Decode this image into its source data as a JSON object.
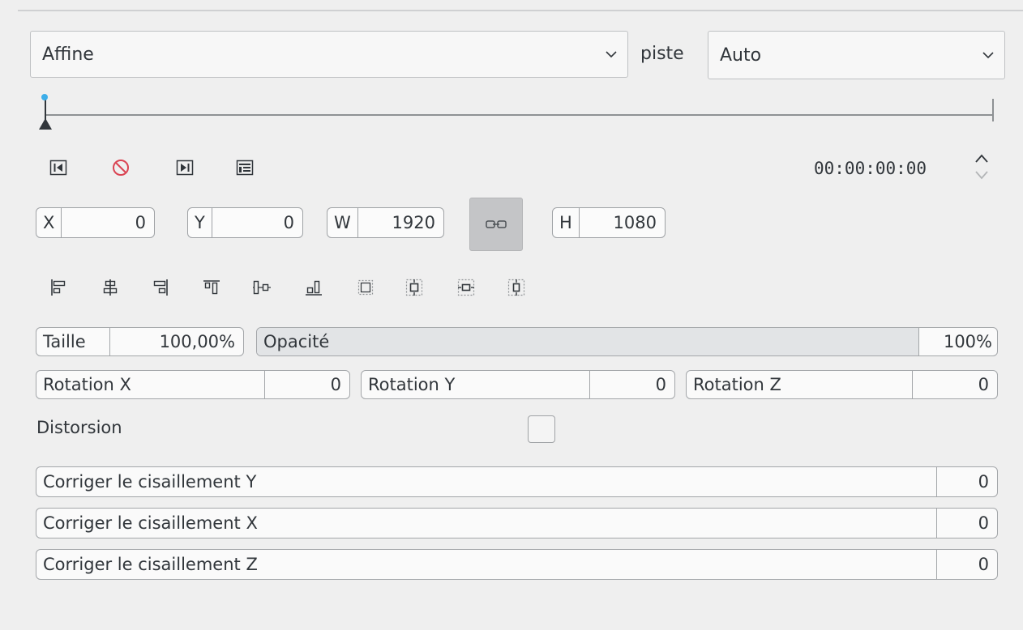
{
  "effect": {
    "selected": "Affine"
  },
  "track": {
    "label": "piste",
    "selected": "Auto"
  },
  "keyframes": {
    "position": 0
  },
  "toolbar": {
    "prev_keyframe": "previous-keyframe-icon",
    "delete_keyframe": "delete-keyframe-icon",
    "next_keyframe": "next-keyframe-icon",
    "keyframe_list": "keyframe-list-icon"
  },
  "timecode": "00:00:00:00",
  "geometry": {
    "x_label": "X",
    "x_value": "0",
    "y_label": "Y",
    "y_value": "0",
    "w_label": "W",
    "w_value": "1920",
    "h_label": "H",
    "h_value": "1080",
    "lock_icon": "link-icon"
  },
  "align_icons": [
    "align-left-icon",
    "align-hcenter-icon",
    "align-right-icon",
    "align-top-icon",
    "align-vcenter-icon",
    "align-bottom-icon",
    "fit-frame-icon",
    "fit-width-icon",
    "fit-height-icon",
    "fit-original-icon"
  ],
  "size": {
    "label": "Taille",
    "value": "100,00%"
  },
  "opacity": {
    "label": "Opacité",
    "value": "100%",
    "level": 1.0
  },
  "rotation": {
    "x_label": "Rotation X",
    "x_value": "0",
    "y_label": "Rotation Y",
    "y_value": "0",
    "z_label": "Rotation Z",
    "z_value": "0"
  },
  "distortion": {
    "label": "Distorsion",
    "checked": false
  },
  "shear": [
    {
      "label": "Corriger le cisaillement Y",
      "value": "0"
    },
    {
      "label": "Corriger le cisaillement X",
      "value": "0"
    },
    {
      "label": "Corriger le cisaillement Z",
      "value": "0"
    }
  ],
  "colors": {
    "accent": "#3daee9",
    "delete": "#da4453"
  }
}
